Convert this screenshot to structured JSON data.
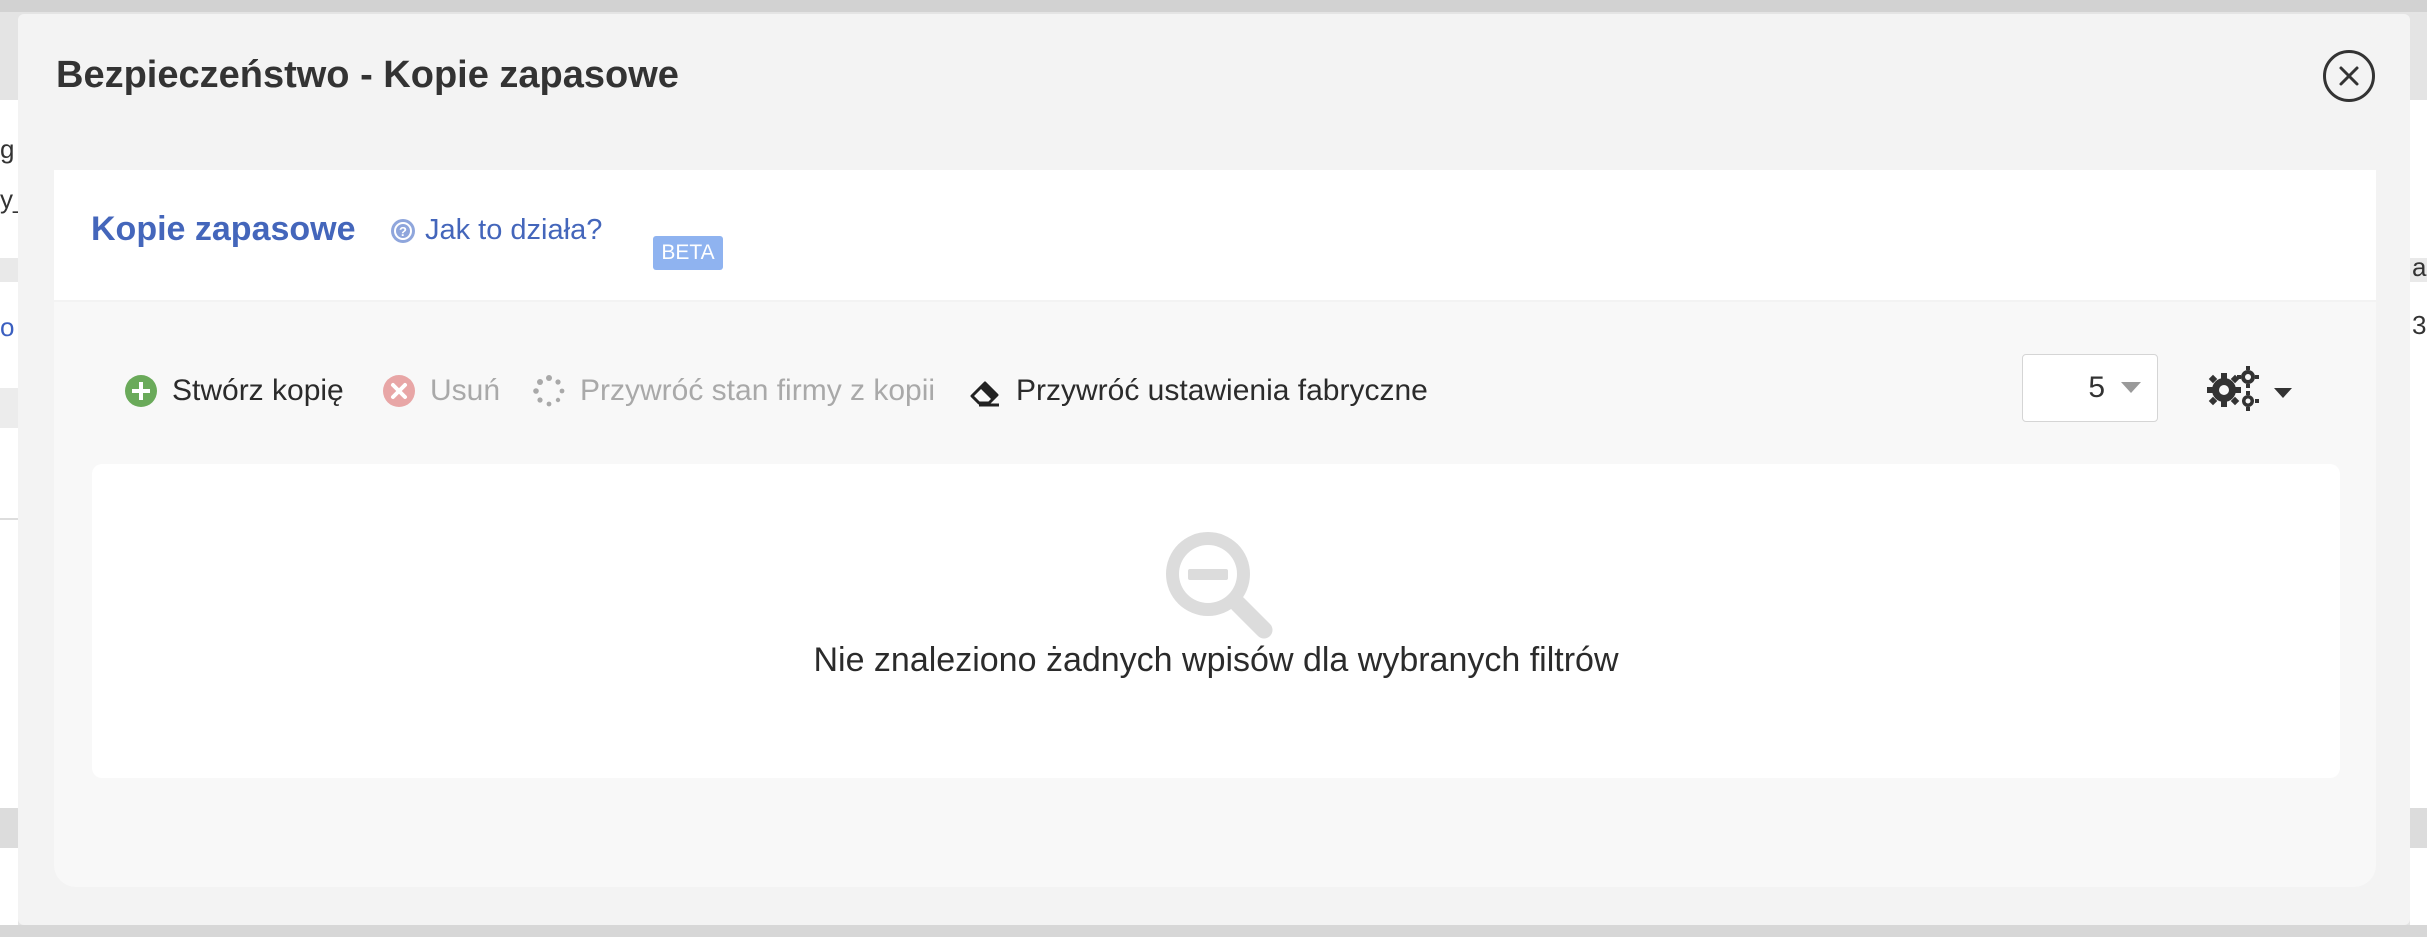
{
  "background": {
    "fragments": [
      "g",
      "y_",
      "o",
      "a",
      "ar",
      "3"
    ]
  },
  "modal": {
    "title": "Bezpieczeństwo - Kopie zapasowe",
    "close_icon": "close-icon"
  },
  "section": {
    "title": "Kopie zapasowe",
    "help_link": "Jak to działa?",
    "help_icon": "question-circle-icon",
    "badge": "BETA"
  },
  "toolbar": {
    "create": {
      "label": "Stwórz kopię",
      "icon": "plus-circle-icon",
      "enabled": true
    },
    "delete": {
      "label": "Usuń",
      "icon": "x-circle-icon",
      "enabled": false
    },
    "restore": {
      "label": "Przywróć stan firmy z kopii",
      "icon": "spinner-icon",
      "enabled": false
    },
    "factory_reset": {
      "label": "Przywróć ustawienia fabryczne",
      "icon": "eraser-icon",
      "enabled": true
    },
    "page_size": {
      "value": "5"
    },
    "settings_icon": "gears-icon"
  },
  "results": {
    "empty_message": "Nie znaleziono żadnych wpisów dla wybranych filtrów",
    "empty_icon": "search-minus-icon"
  },
  "colors": {
    "accent": "#4466bb",
    "beta_badge": "#8fb3f0",
    "create_green": "#6aaa5a",
    "delete_red": "#e8a6a6"
  }
}
